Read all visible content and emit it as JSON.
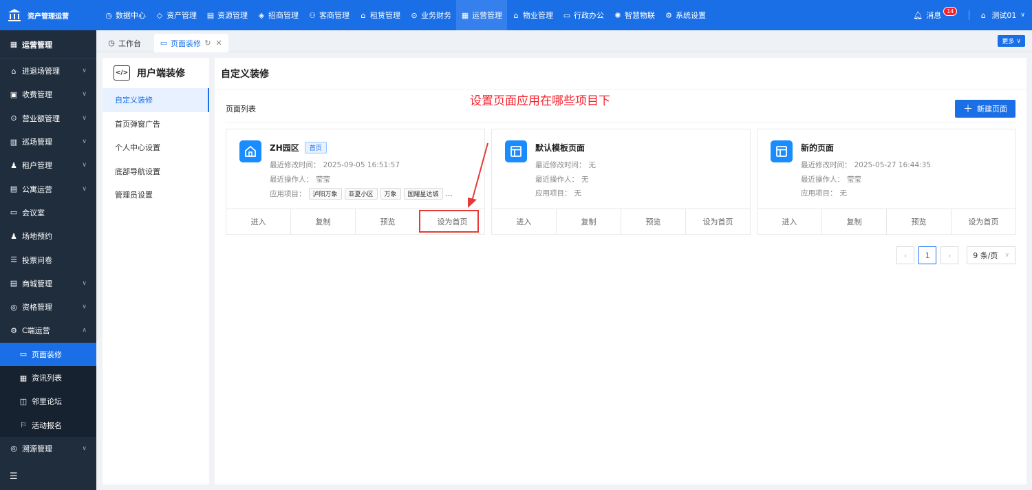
{
  "topbar": {
    "logo_text": "资产管理运营",
    "nav": [
      {
        "label": "数据中心",
        "icon": "clock-icon"
      },
      {
        "label": "资产管理",
        "icon": "cube-icon"
      },
      {
        "label": "资源管理",
        "icon": "building-icon"
      },
      {
        "label": "招商管理",
        "icon": "tag-icon"
      },
      {
        "label": "客商管理",
        "icon": "users-icon"
      },
      {
        "label": "租赁管理",
        "icon": "home-icon"
      },
      {
        "label": "业务财务",
        "icon": "money-icon"
      },
      {
        "label": "运营管理",
        "icon": "grid-icon",
        "active": true
      },
      {
        "label": "物业管理",
        "icon": "house-icon"
      },
      {
        "label": "行政办公",
        "icon": "monitor-icon"
      },
      {
        "label": "智慧物联",
        "icon": "iot-icon"
      },
      {
        "label": "系统设置",
        "icon": "gear-icon"
      }
    ],
    "messages_label": "消息",
    "messages_count": "14",
    "user_label": "测试01"
  },
  "sidebar": {
    "title": "运营管理",
    "items": [
      {
        "label": "进退场管理",
        "chevron": "down"
      },
      {
        "label": "收费管理",
        "chevron": "down"
      },
      {
        "label": "营业额管理",
        "chevron": "down"
      },
      {
        "label": "巡场管理",
        "chevron": "down"
      },
      {
        "label": "租户管理",
        "chevron": "down"
      },
      {
        "label": "公寓运营",
        "chevron": "down"
      },
      {
        "label": "会议室"
      },
      {
        "label": "场地预约"
      },
      {
        "label": "投票问卷"
      },
      {
        "label": "商城管理",
        "chevron": "down"
      },
      {
        "label": "资格管理",
        "chevron": "down"
      },
      {
        "label": "C端运营",
        "chevron": "up"
      }
    ],
    "subitems": [
      {
        "label": "页面装修",
        "active": true
      },
      {
        "label": "资讯列表"
      },
      {
        "label": "邻里论坛"
      },
      {
        "label": "活动报名"
      }
    ],
    "last_item": {
      "label": "溯源管理",
      "chevron": "down"
    }
  },
  "tabs": [
    {
      "label": "工作台"
    },
    {
      "label": "页面装修",
      "active": true
    }
  ],
  "more_label": "更多",
  "left_panel": {
    "title": "用户端装修",
    "items": [
      {
        "label": "自定义装修",
        "active": true
      },
      {
        "label": "首页弹窗广告"
      },
      {
        "label": "个人中心设置"
      },
      {
        "label": "底部导航设置"
      },
      {
        "label": "管理员设置"
      }
    ]
  },
  "main": {
    "title": "自定义装修",
    "annotation": "设置页面应用在哪些项目下",
    "list_title": "页面列表",
    "new_button": "新建页面"
  },
  "cards": [
    {
      "title": "ZH园区",
      "tag": "首页",
      "icon": "home-icon",
      "modified_label": "最近修改时间：",
      "modified": "2025-09-05 16:51:57",
      "operator_label": "最近操作人：",
      "operator": "莹莹",
      "projects_label": "应用项目：",
      "projects": [
        "泸阳万象",
        "亚夏小区",
        "万象",
        "国耀星达城"
      ],
      "projects_more": "...",
      "actions": [
        "进入",
        "复制",
        "预览",
        "设为首页"
      ]
    },
    {
      "title": "默认模板页面",
      "icon": "layout-icon",
      "modified_label": "最近修改时间：",
      "modified": "无",
      "operator_label": "最近操作人：",
      "operator": "无",
      "projects_label": "应用项目：",
      "projects_text": "无",
      "actions": [
        "进入",
        "复制",
        "预览",
        "设为首页"
      ]
    },
    {
      "title": "新的页面",
      "icon": "layout-icon",
      "modified_label": "最近修改时间：",
      "modified": "2025-05-27 16:44:35",
      "operator_label": "最近操作人：",
      "operator": "莹莹",
      "projects_label": "应用项目：",
      "projects_text": "无",
      "actions": [
        "进入",
        "复制",
        "预览",
        "设为首页"
      ]
    }
  ],
  "pagination": {
    "current": "1",
    "page_size": "9 条/页"
  },
  "colors": {
    "primary": "#1a6fe6",
    "sidebar_bg": "#1f2d3d",
    "annotation_red": "#e53935"
  }
}
